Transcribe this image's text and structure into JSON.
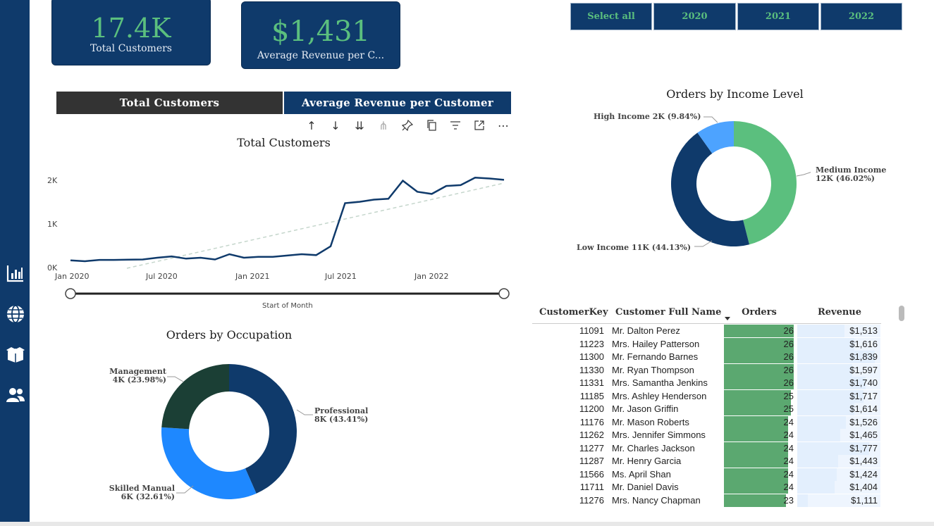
{
  "kpis": {
    "total_customers": {
      "value": "17.4K",
      "label": "Total Customers"
    },
    "avg_revenue": {
      "value": "$1,431",
      "label": "Average Revenue per C..."
    }
  },
  "year_slicer": [
    "Select all",
    "2020",
    "2021",
    "2022"
  ],
  "toggle": {
    "left": "Total Customers",
    "right": "Average Revenue per Customer"
  },
  "colors": {
    "navy": "#0f3a6b",
    "green": "#5bbf7e",
    "dark_green": "#1b3f35",
    "blue": "#1e88ff",
    "light_blue": "#4da3ff",
    "table_green": "#5ba870",
    "table_blue": "#e3effd"
  },
  "toolbar_icons": [
    "arrow-up-icon",
    "arrow-down-icon",
    "double-arrow-down-icon",
    "expand-hierarchy-icon",
    "pin-icon",
    "copy-icon",
    "filter-icon",
    "focus-mode-icon",
    "more-options-icon"
  ],
  "line_chart": {
    "title": "Total Customers",
    "x_axis_title": "Start of Month",
    "x_ticks": [
      "Jan 2020",
      "Jul 2020",
      "Jan 2021",
      "Jul 2021",
      "Jan 2022"
    ],
    "y_ticks": [
      "0K",
      "1K",
      "2K"
    ]
  },
  "occupation_chart": {
    "title": "Orders by Occupation",
    "labels": [
      {
        "name": "Management",
        "value": "4K (23.98%)"
      },
      {
        "name": "Professional",
        "value": "8K (43.41%)"
      },
      {
        "name": "Skilled Manual",
        "value": "6K (32.61%)"
      }
    ]
  },
  "income_chart": {
    "title": "Orders by Income Level",
    "labels": [
      {
        "name": "High Income",
        "value": "2K (9.84%)"
      },
      {
        "name": "Medium Income",
        "value": "12K (46.02%)"
      },
      {
        "name": "Low Income",
        "value": "11K (44.13%)"
      }
    ]
  },
  "chart_data": [
    {
      "type": "line",
      "title": "Total Customers",
      "xlabel": "Start of Month",
      "ylabel": "",
      "ylim": [
        0,
        2500
      ],
      "x": [
        "2020-01",
        "2020-02",
        "2020-03",
        "2020-04",
        "2020-05",
        "2020-06",
        "2020-07",
        "2020-08",
        "2020-09",
        "2020-10",
        "2020-11",
        "2020-12",
        "2021-01",
        "2021-02",
        "2021-03",
        "2021-04",
        "2021-05",
        "2021-06",
        "2021-07",
        "2021-08",
        "2021-09",
        "2021-10",
        "2021-11",
        "2021-12",
        "2022-01",
        "2022-02",
        "2022-03",
        "2022-04",
        "2022-05",
        "2022-06",
        "2022-07"
      ],
      "series": [
        {
          "values": [
            180,
            160,
            190,
            190,
            195,
            200,
            240,
            270,
            220,
            240,
            200,
            320,
            240,
            260,
            260,
            290,
            320,
            300,
            500,
            1480,
            1510,
            1560,
            1580,
            1990,
            1740,
            1690,
            1870,
            1890,
            2060,
            2040,
            2010
          ]
        }
      ],
      "trendline": true
    },
    {
      "type": "pie",
      "donut": true,
      "title": "Orders by Occupation",
      "categories": [
        "Professional",
        "Skilled Manual",
        "Management"
      ],
      "values": [
        43.41,
        32.61,
        23.98
      ]
    },
    {
      "type": "pie",
      "donut": true,
      "title": "Orders by Income Level",
      "categories": [
        "Medium Income",
        "Low Income",
        "High Income"
      ],
      "values": [
        46.02,
        44.13,
        9.84
      ]
    }
  ],
  "table": {
    "headers": [
      "CustomerKey",
      "Customer Full Name",
      "Orders",
      "Revenue"
    ],
    "rows": [
      {
        "key": "11091",
        "name": "Mr. Dalton Perez",
        "orders": "26",
        "revenue": "$1,513",
        "o": 26,
        "r": 1513
      },
      {
        "key": "11223",
        "name": "Mrs. Hailey Patterson",
        "orders": "26",
        "revenue": "$1,616",
        "o": 26,
        "r": 1616
      },
      {
        "key": "11300",
        "name": "Mr. Fernando Barnes",
        "orders": "26",
        "revenue": "$1,839",
        "o": 26,
        "r": 1839
      },
      {
        "key": "11330",
        "name": "Mr. Ryan Thompson",
        "orders": "26",
        "revenue": "$1,597",
        "o": 26,
        "r": 1597
      },
      {
        "key": "11331",
        "name": "Mrs. Samantha Jenkins",
        "orders": "26",
        "revenue": "$1,740",
        "o": 26,
        "r": 1740
      },
      {
        "key": "11185",
        "name": "Mrs. Ashley Henderson",
        "orders": "25",
        "revenue": "$1,717",
        "o": 25,
        "r": 1717
      },
      {
        "key": "11200",
        "name": "Mr. Jason Griffin",
        "orders": "25",
        "revenue": "$1,614",
        "o": 25,
        "r": 1614
      },
      {
        "key": "11176",
        "name": "Mr. Mason Roberts",
        "orders": "24",
        "revenue": "$1,526",
        "o": 24,
        "r": 1526
      },
      {
        "key": "11262",
        "name": "Mrs. Jennifer Simmons",
        "orders": "24",
        "revenue": "$1,465",
        "o": 24,
        "r": 1465
      },
      {
        "key": "11277",
        "name": "Mr. Charles Jackson",
        "orders": "24",
        "revenue": "$1,777",
        "o": 24,
        "r": 1777
      },
      {
        "key": "11287",
        "name": "Mr. Henry Garcia",
        "orders": "24",
        "revenue": "$1,443",
        "o": 24,
        "r": 1443
      },
      {
        "key": "11566",
        "name": "Ms. April Shan",
        "orders": "24",
        "revenue": "$1,424",
        "o": 24,
        "r": 1424
      },
      {
        "key": "11711",
        "name": "Mr. Daniel Davis",
        "orders": "24",
        "revenue": "$1,404",
        "o": 24,
        "r": 1404
      },
      {
        "key": "11276",
        "name": "Mrs. Nancy Chapman",
        "orders": "23",
        "revenue": "$1,111",
        "o": 23,
        "r": 1111
      }
    ]
  }
}
